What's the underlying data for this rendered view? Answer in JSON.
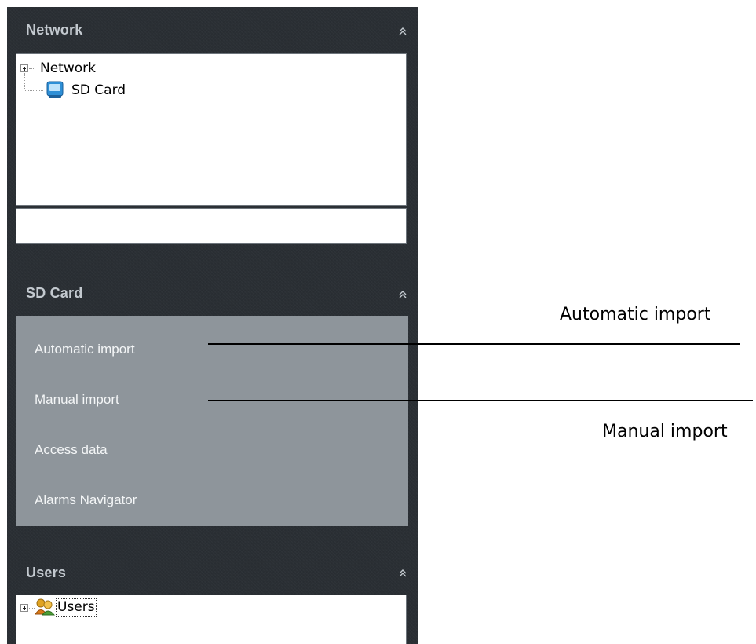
{
  "panels": {
    "network": {
      "title": "Network",
      "tree": [
        {
          "label": "Network",
          "expandable": true
        },
        {
          "label": "SD Card",
          "icon": "sd-card-icon"
        }
      ],
      "status_text": ""
    },
    "sd_card": {
      "title": "SD Card",
      "menu_items": [
        "Automatic import",
        "Manual import",
        "Access data",
        "Alarms Navigator"
      ]
    },
    "users": {
      "title": "Users",
      "tree": [
        {
          "label": "Users",
          "expandable": true,
          "icon": "users-icon",
          "focused": true
        }
      ]
    }
  },
  "callouts": {
    "automatic_import": "Automatic import",
    "manual_import": "Manual import"
  },
  "colors": {
    "sidebar_bg": "#2a2f34",
    "panel_title": "#c3c9cf",
    "menu_bg": "#8e959b",
    "menu_text": "#f4f6f7"
  }
}
